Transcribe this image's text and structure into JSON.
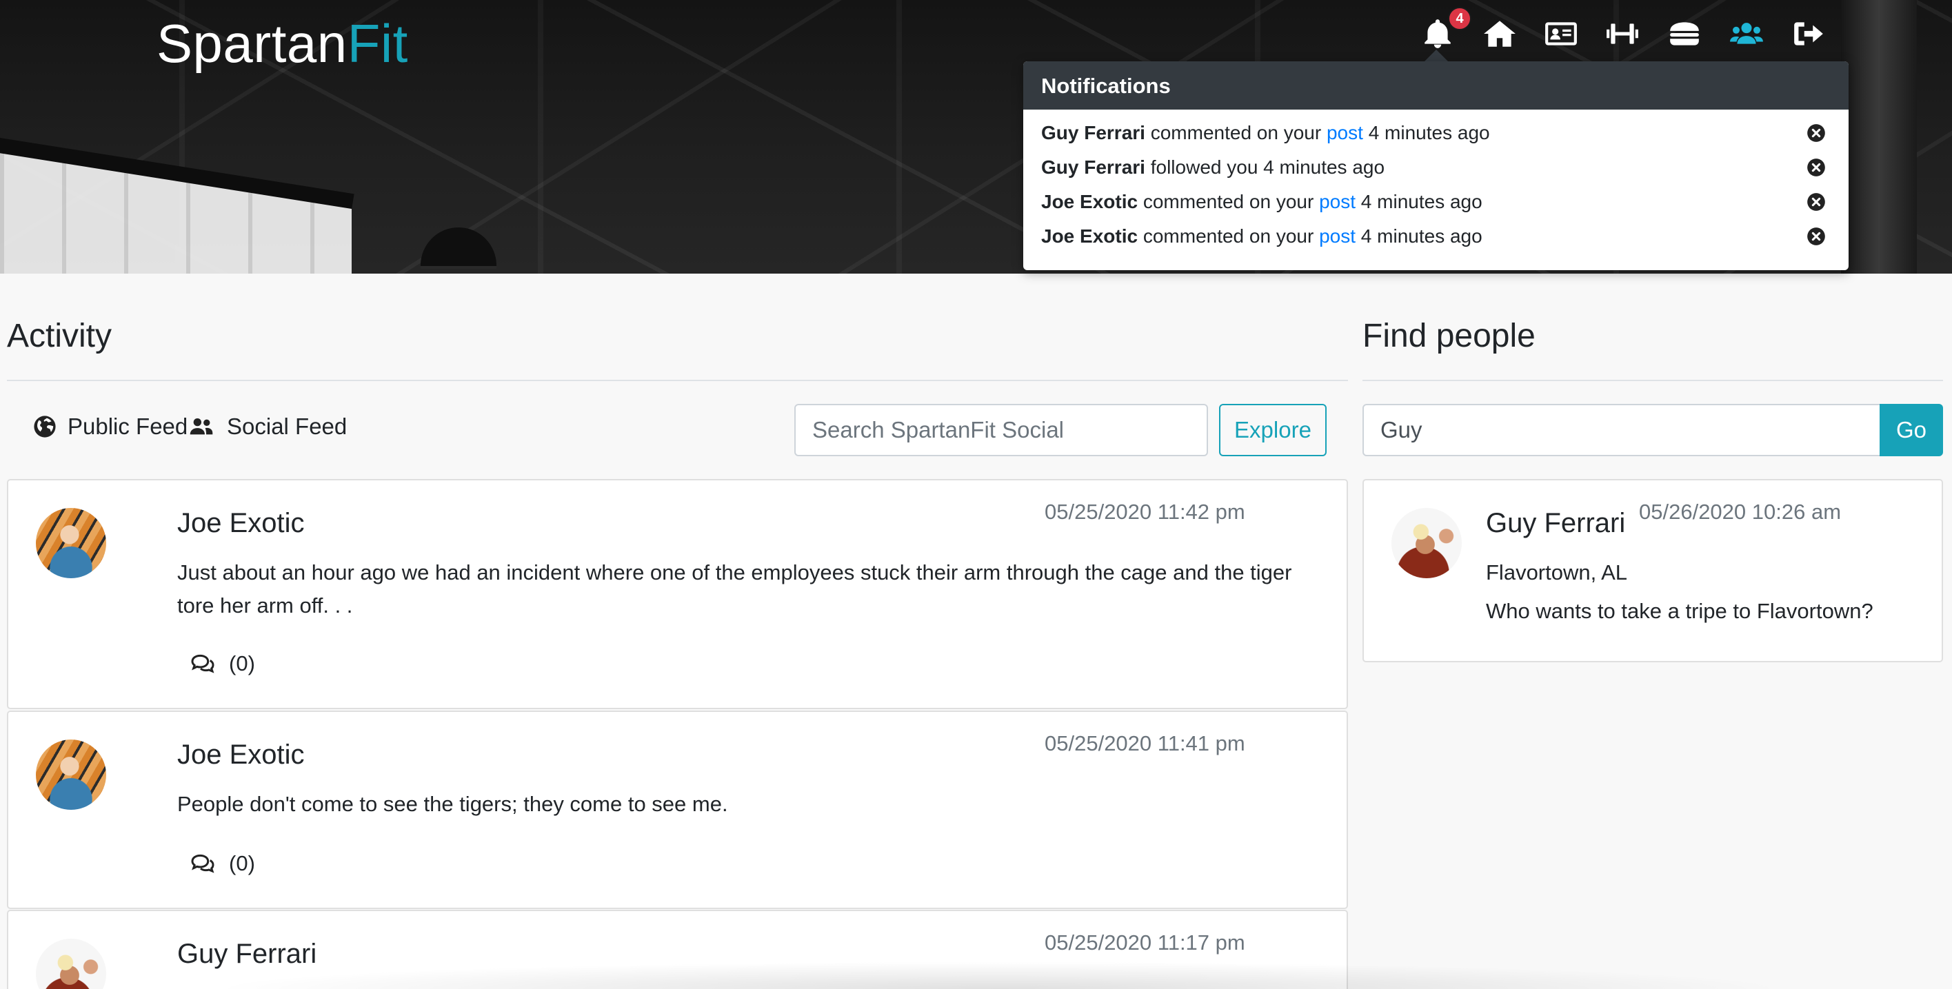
{
  "brand": {
    "name_main": "Spartan",
    "name_accent": "Fit",
    "accent_color": "#17a2b8"
  },
  "nav": {
    "notification_count": "4",
    "icons": [
      "bell-icon",
      "home-icon",
      "id-card-icon",
      "dumbbell-icon",
      "burger-icon",
      "users-icon",
      "sign-out-icon"
    ],
    "active_icon": "users-icon"
  },
  "notifications": {
    "title": "Notifications",
    "items": [
      {
        "user": "Guy Ferrari",
        "text": " commented on your ",
        "link": "post",
        "time": " 4 minutes ago"
      },
      {
        "user": "Guy Ferrari",
        "text": " followed you 4 minutes ago",
        "link": "",
        "time": ""
      },
      {
        "user": "Joe Exotic",
        "text": " commented on your ",
        "link": "post",
        "time": " 4 minutes ago"
      },
      {
        "user": "Joe Exotic",
        "text": " commented on your ",
        "link": "post",
        "time": " 4 minutes ago"
      }
    ]
  },
  "activity": {
    "title": "Activity",
    "public_feed_label": "Public Feed",
    "social_feed_label": "Social Feed",
    "search_placeholder": "Search SpartanFit Social",
    "explore_label": "Explore",
    "posts": [
      {
        "author": "Joe Exotic",
        "date": "05/25/2020 11:42 pm",
        "body_line1": "Just about an hour ago we had an incident where one of the employees stuck their arm through the cage and the tiger",
        "body_line2": "tore her arm off. . .",
        "comments": "(0)"
      },
      {
        "author": "Joe Exotic",
        "date": "05/25/2020 11:41 pm",
        "body_line1": "People don't come to see the tigers; they come to see me.",
        "body_line2": "",
        "comments": "(0)"
      },
      {
        "author": "Guy Ferrari",
        "date": "05/25/2020 11:17 pm",
        "body_line1": "",
        "body_line2": "",
        "comments": ""
      }
    ]
  },
  "find_people": {
    "title": "Find people",
    "search_value": "Guy",
    "go_label": "Go",
    "results": [
      {
        "name": "Guy Ferrari",
        "date": "05/26/2020 10:26 am",
        "location": "Flavortown, AL",
        "bio": "Who wants to take a tripe to Flavortown?"
      }
    ]
  }
}
